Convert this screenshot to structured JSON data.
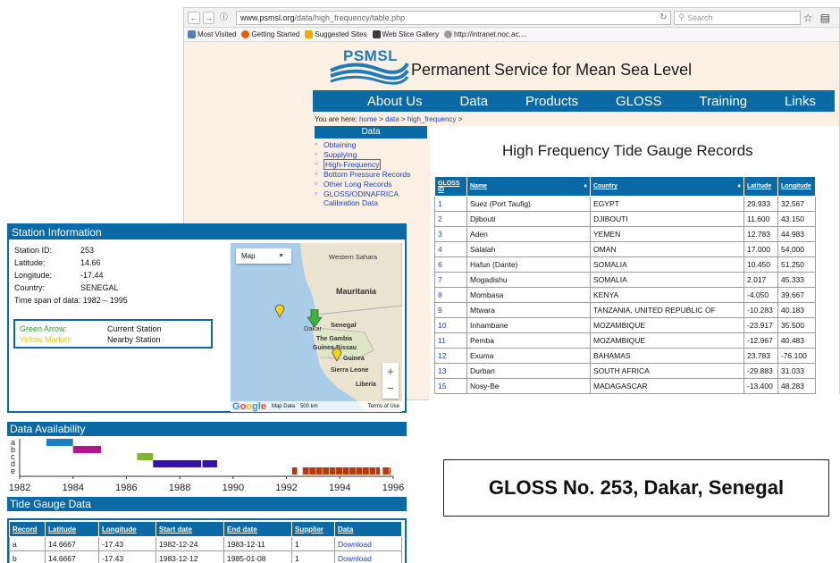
{
  "browser": {
    "url_host": "www.psmsl.org",
    "url_path": "/data/high_frequency/table.php",
    "search_placeholder": "Search",
    "bookmarks": [
      "Most Visited",
      "Getting Started",
      "Suggested Sites",
      "Web Slice Gallery",
      "http://intranet.noc.ac...."
    ]
  },
  "site": {
    "logo_text": "PSMSL",
    "title": "Permanent Service for Mean Sea Level",
    "nav": [
      "About Us",
      "Data",
      "Products",
      "GLOSS",
      "Training",
      "Links"
    ],
    "breadcrumb_prefix": "You are here:",
    "breadcrumb": [
      "home",
      "data",
      "high_frequency"
    ],
    "sidebar_title": "Data",
    "sidebar_items": [
      "Obtaining",
      "Supplying",
      "High-Frequency",
      "Bottom Pressure Records",
      "Other Long Records",
      "GLOSS/ODINAFRICA Calibration Data"
    ],
    "heading": "High Frequency Tide Gauge Records"
  },
  "gloss_table": {
    "headers": [
      "GLOSS ID",
      "Name",
      "Country",
      "Latitude",
      "Longitude"
    ],
    "rows": [
      [
        "1",
        "Suez (Port Taufig)",
        "EGYPT",
        "29.933",
        "32.567"
      ],
      [
        "2",
        "Djibouti",
        "DJIBOUTI",
        "11.600",
        "43.150"
      ],
      [
        "3",
        "Aden",
        "YEMEN",
        "12.783",
        "44.983"
      ],
      [
        "4",
        "Salalah",
        "OMAN",
        "17.000",
        "54.000"
      ],
      [
        "6",
        "Hafun (Dante)",
        "SOMALIA",
        "10.450",
        "51.250"
      ],
      [
        "7",
        "Mogadishu",
        "SOMALIA",
        "2.017",
        "45.333"
      ],
      [
        "8",
        "Mombasa",
        "KENYA",
        "-4.050",
        "39.667"
      ],
      [
        "9",
        "Mtwara",
        "TANZANIA, UNITED REPUBLIC OF",
        "-10.283",
        "40.183"
      ],
      [
        "10",
        "Inhambane",
        "MOZAMBIQUE",
        "-23.917",
        "35.500"
      ],
      [
        "11",
        "Pemba",
        "MOZAMBIQUE",
        "-12.967",
        "40.483"
      ],
      [
        "12",
        "Exuma",
        "BAHAMAS",
        "23.783",
        "-76.100"
      ],
      [
        "13",
        "Durban",
        "SOUTH AFRICA",
        "-29.883",
        "31.033"
      ],
      [
        "15",
        "Nosy-Be",
        "MADAGASCAR",
        "-13.400",
        "48.283"
      ]
    ]
  },
  "station": {
    "title": "Station Information",
    "fields": [
      {
        "label": "Station ID:",
        "value": "253"
      },
      {
        "label": "Latitude:",
        "value": "14.66"
      },
      {
        "label": "Longitude:",
        "value": "-17.44"
      },
      {
        "label": "Country:",
        "value": "SENEGAL"
      }
    ],
    "time_span_label": "Time span of data:",
    "time_span_value": "1982 – 1995",
    "legend": [
      {
        "key": "Green Arrow:",
        "value": "Current Station",
        "color": "#2e9e2e"
      },
      {
        "key": "Yellow Marker:",
        "value": "Nearby Station",
        "color": "#e8c21a"
      }
    ],
    "map": {
      "type_label": "Map",
      "labels": [
        "Western Sahara",
        "Mauritania",
        "Dakar",
        "Senegal",
        "The Gambia",
        "Guinea-Bissau",
        "Guinea",
        "Sierra Leone",
        "Liberia"
      ],
      "attribution": [
        "Map Data",
        "500 km",
        "Terms of Use"
      ],
      "logo": "Google"
    }
  },
  "chart_data": {
    "type": "bar",
    "title": "Data Availability",
    "categories": [
      "a",
      "b",
      "c",
      "d",
      "e"
    ],
    "xlim": [
      1982,
      1996
    ],
    "x_ticks": [
      1982,
      1984,
      1986,
      1988,
      1990,
      1992,
      1994,
      1996
    ],
    "series": [
      {
        "category": "a",
        "segments": [
          [
            1983.0,
            1984.0
          ]
        ],
        "color": "#1b7fc0"
      },
      {
        "category": "b",
        "segments": [
          [
            1984.0,
            1985.05
          ]
        ],
        "color": "#b0178c"
      },
      {
        "category": "c",
        "segments": [
          [
            1986.4,
            1987.0
          ]
        ],
        "color": "#7cb82a"
      },
      {
        "category": "d",
        "segments": [
          [
            1987.0,
            1988.8
          ],
          [
            1988.85,
            1989.4
          ]
        ],
        "color": "#3313a8"
      },
      {
        "category": "e",
        "segments": [
          [
            1992.2,
            1992.4
          ],
          [
            1992.6,
            1995.5
          ],
          [
            1995.6,
            1995.9
          ]
        ],
        "color": "#b33a0c"
      }
    ]
  },
  "tide_gauge": {
    "title": "Tide Gauge Data",
    "headers": [
      "Record",
      "Latitude",
      "Longitude",
      "Start date",
      "End date",
      "Supplier",
      "Data"
    ],
    "rows": [
      [
        "a",
        "14.6667",
        "-17.43",
        "1982-12-24",
        "1983-12-11",
        "1",
        "Download"
      ],
      [
        "b",
        "14.6667",
        "-17.43",
        "1983-12-12",
        "1985-01-08",
        "1",
        "Download"
      ]
    ]
  },
  "caption": "GLOSS No. 253, Dakar, Senegal"
}
